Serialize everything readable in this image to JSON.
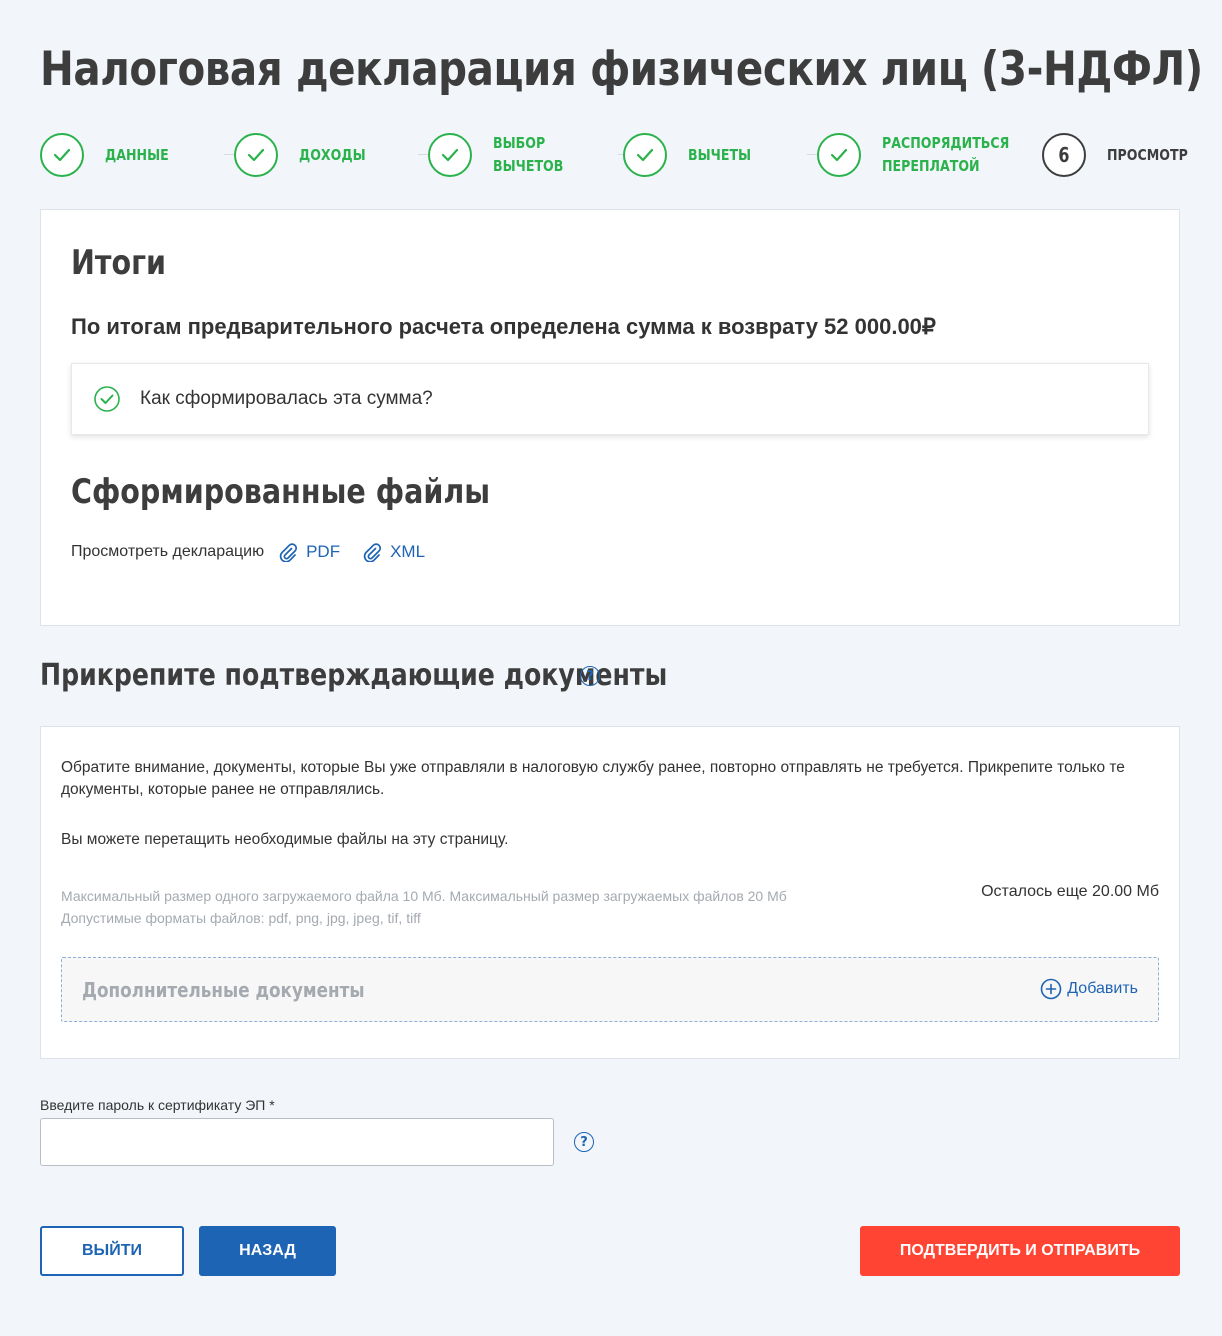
{
  "page": {
    "title": "Налоговая декларация физических лиц (3-НДФЛ)"
  },
  "stepper": {
    "steps": [
      {
        "label": "Данные",
        "status": "done"
      },
      {
        "label": "Доходы",
        "status": "done"
      },
      {
        "label": "Выбор вычетов",
        "status": "done"
      },
      {
        "label": "Вычеты",
        "status": "done"
      },
      {
        "label": "Распорядиться переплатой",
        "status": "done"
      },
      {
        "label": "Просмотр",
        "status": "current",
        "number": "6"
      }
    ]
  },
  "summary": {
    "title": "Итоги",
    "text": "По итогам предварительного расчета определена сумма к возврату 52 000.00₽",
    "accordion_label": "Как сформировалась эта сумма?",
    "files_title": "Сформированные файлы",
    "view_label": "Просмотреть декларацию",
    "links": [
      "PDF",
      "XML"
    ]
  },
  "attach": {
    "title": "Прикрепите подтверждающие документы",
    "help_glyph": "?",
    "notice": "Обратите внимание, документы, которые Вы уже отправляли в налоговую службу ранее, повторно отправлять не требуется. Прикрепите только те документы, которые ранее не отправлялись.",
    "drag_hint": "Вы можете перетащить необходимые файлы на эту страницу.",
    "limit_size": "Максимальный размер одного загружаемого файла 10 Мб. Максимальный размер загружаемых файлов 20 Мб",
    "limit_formats": "Допустимые форматы файлов: pdf, png, jpg, jpeg, tif, tiff",
    "remaining": "Осталось еще 20.00 Мб",
    "dropzone_label": "Дополнительные документы",
    "add_label": "Добавить"
  },
  "password": {
    "label": "Введите пароль к сертификату ЭП *",
    "value": "",
    "help_glyph": "?"
  },
  "buttons": {
    "exit": "Выйти",
    "back": "Назад",
    "submit": "Подтвердить и отправить"
  },
  "colors": {
    "accent": "#1e64b4",
    "success": "#2bb24c",
    "danger": "#ff4433",
    "background": "#f2f6fa"
  },
  "icons": {
    "step_done": "check-icon",
    "accordion": "check-circle-icon",
    "file_link": "paperclip-icon",
    "help": "question-circle-icon",
    "add": "plus-circle-icon"
  }
}
